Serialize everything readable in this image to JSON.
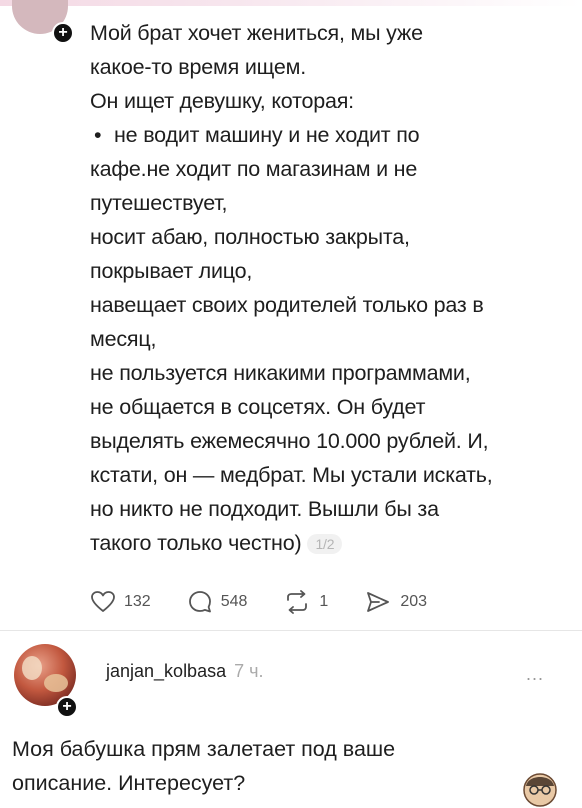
{
  "post": {
    "lines": [
      "Мой брат хочет жениться, мы уже",
      "какое-то время ищем.",
      "Он ищет девушку, которая:",
      "не водит машину и не ходит по",
      "кафе.не ходит по магазинам и не",
      "путешествует,",
      "носит абаю, полностью закрыта,",
      "покрывает лицо,",
      "навещает своих родителей только раз в",
      "месяц,",
      "не пользуется никакими программами,",
      "не общается в соцсетях. Он будет",
      "выделять ежемесячно 10.000 рублей. И,",
      "кстати, он — медбрат. Мы устали искать,",
      "но никто не подходит. Вышли бы за",
      "такого только честно)"
    ],
    "page_indicator": "1/2"
  },
  "stats": {
    "likes": "132",
    "comments": "548",
    "reposts": "1",
    "shares": "203"
  },
  "reply": {
    "username": "janjan_kolbasa",
    "time": "7 ч.",
    "more": "...",
    "lines": [
      "Моя бабушка прям залетает под ваше",
      "описание. Интересует?"
    ]
  },
  "icons": {
    "like": "heart-icon",
    "comment": "comment-icon",
    "repost": "repost-icon",
    "share": "share-icon",
    "follow": "plus-icon"
  }
}
